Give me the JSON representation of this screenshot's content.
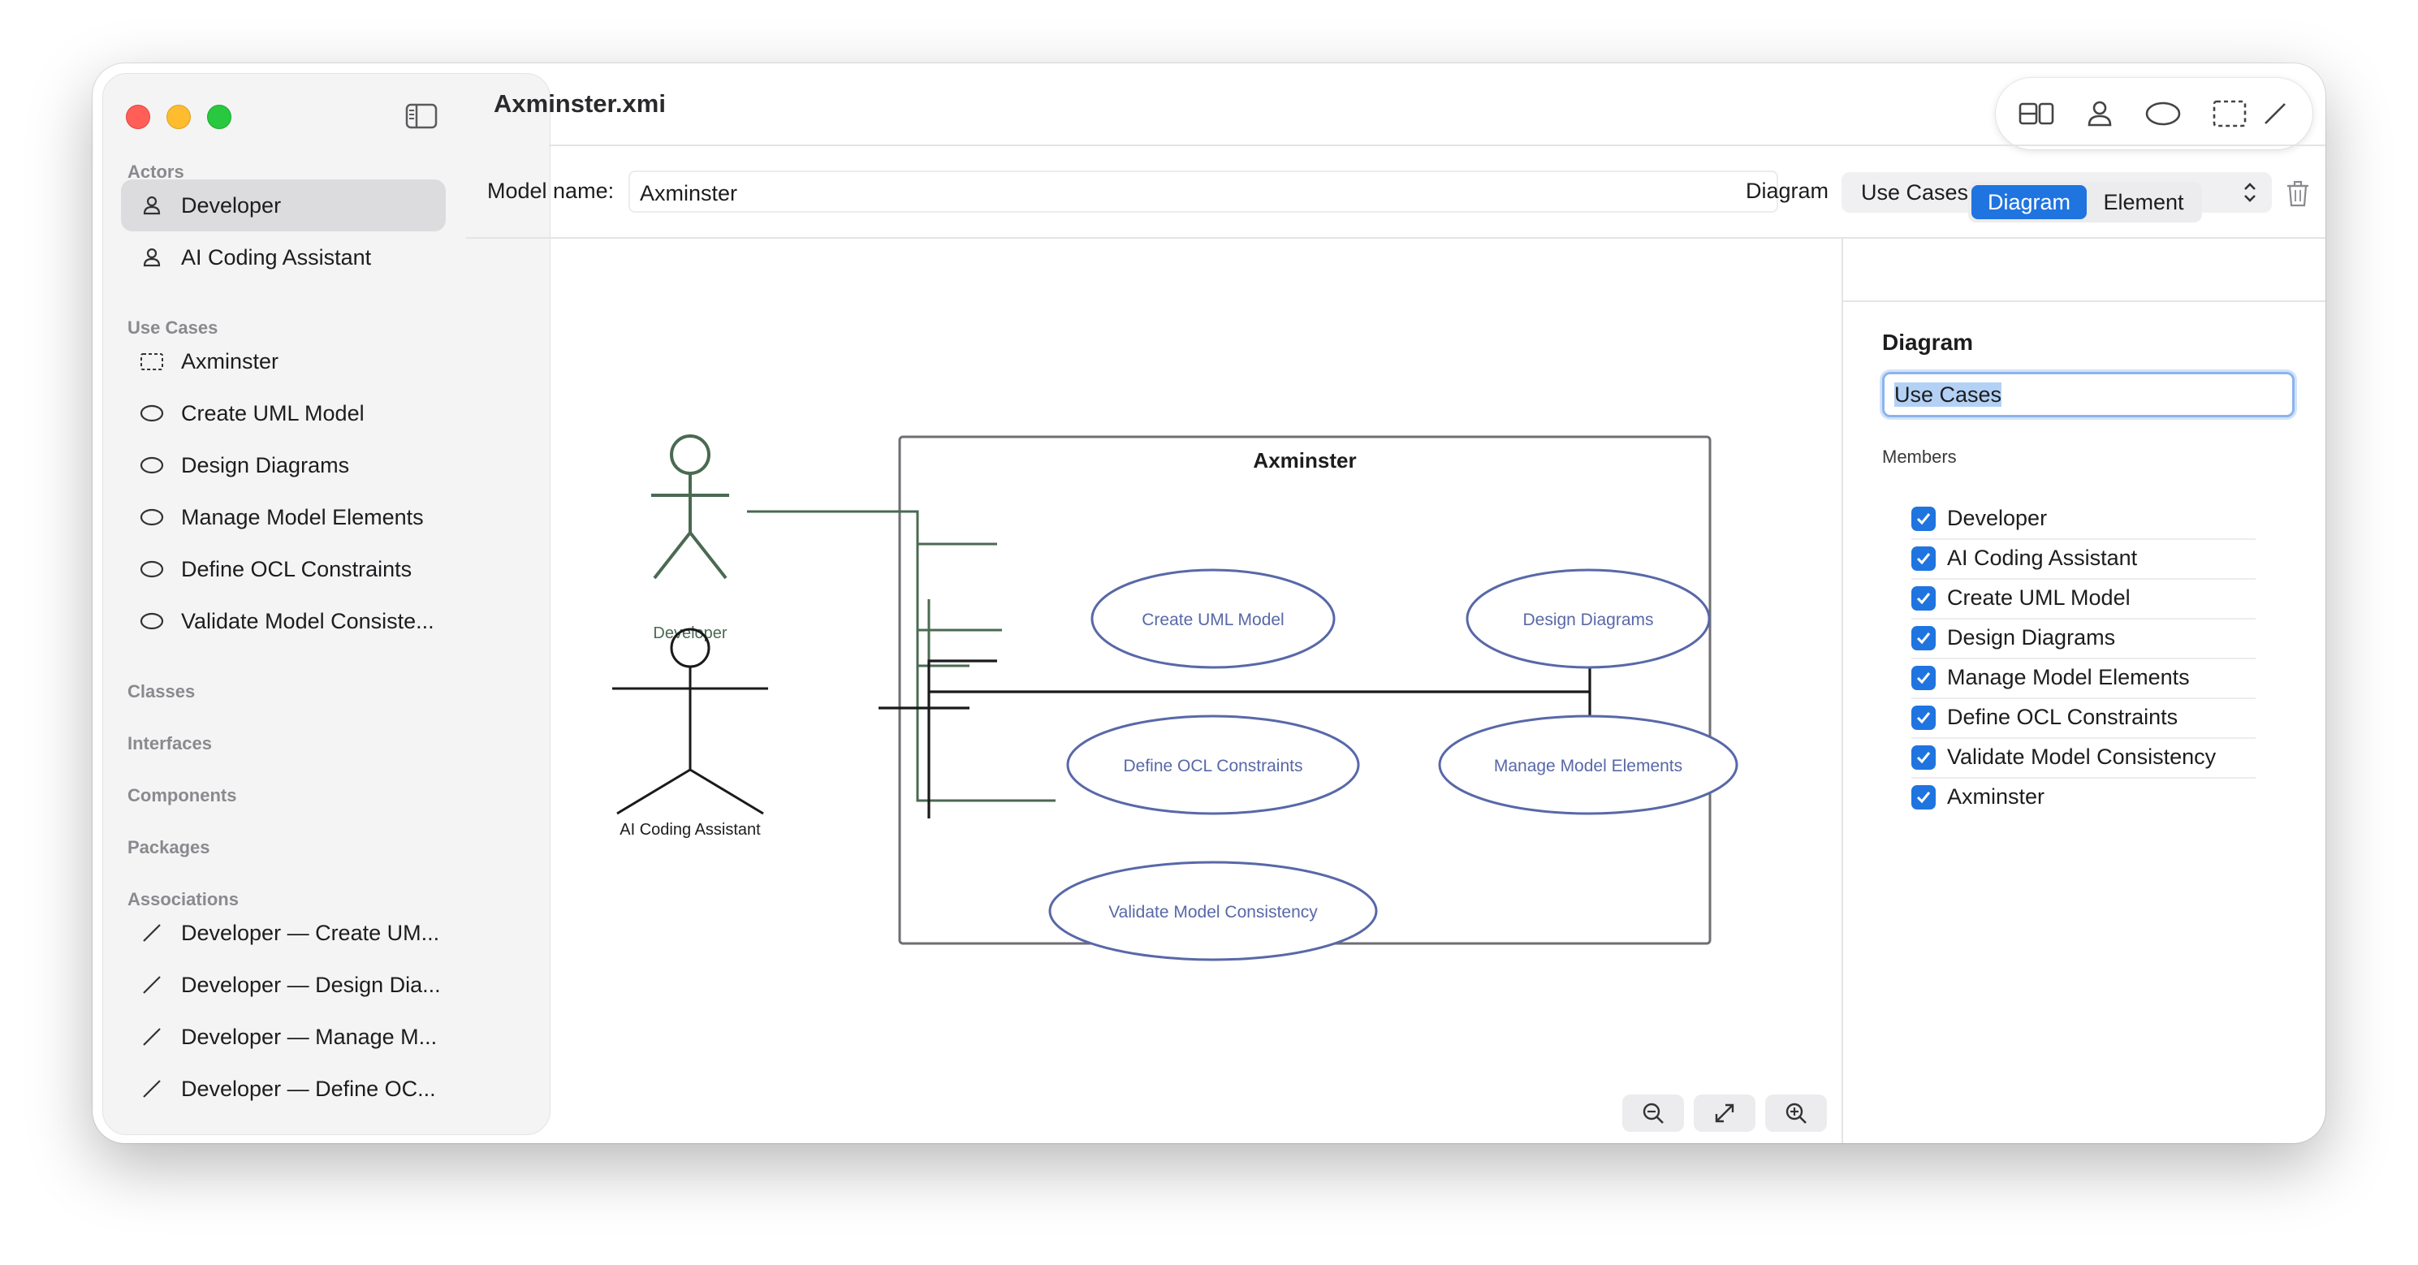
{
  "window": {
    "title": "Axminster.xmi"
  },
  "sidebar": {
    "sections": [
      {
        "title": "Actors",
        "items": [
          {
            "label": "Developer",
            "icon": "person-icon",
            "selected": true
          },
          {
            "label": "AI Coding Assistant",
            "icon": "person-icon"
          }
        ]
      },
      {
        "title": "Use Cases",
        "items": [
          {
            "label": "Axminster",
            "icon": "boundary-icon"
          },
          {
            "label": "Create UML Model",
            "icon": "ellipse-icon"
          },
          {
            "label": "Design Diagrams",
            "icon": "ellipse-icon"
          },
          {
            "label": "Manage Model Elements",
            "icon": "ellipse-icon"
          },
          {
            "label": "Define OCL Constraints",
            "icon": "ellipse-icon"
          },
          {
            "label": "Validate Model Consiste...",
            "icon": "ellipse-icon"
          }
        ]
      },
      {
        "title": "Classes",
        "items": []
      },
      {
        "title": "Interfaces",
        "items": []
      },
      {
        "title": "Components",
        "items": []
      },
      {
        "title": "Packages",
        "items": []
      },
      {
        "title": "Associations",
        "items": [
          {
            "label": "Developer — Create UM...",
            "icon": "line-icon"
          },
          {
            "label": "Developer — Design Dia...",
            "icon": "line-icon"
          },
          {
            "label": "Developer — Manage M...",
            "icon": "line-icon"
          },
          {
            "label": "Developer — Define OC...",
            "icon": "line-icon"
          }
        ]
      }
    ]
  },
  "toolbar": {
    "buttons": [
      "layout-icon",
      "actor-tool-icon",
      "use-case-tool-icon",
      "boundary-tool-icon",
      "association-tool-icon"
    ]
  },
  "model": {
    "name_label": "Model name:",
    "name_value": "Axminster",
    "diagram_label": "Diagram",
    "diagram_value": "Use Cases"
  },
  "diagram": {
    "system_name": "Axminster",
    "actors": [
      "Developer",
      "AI Coding Assistant"
    ],
    "use_cases": [
      "Create UML Model",
      "Design Diagrams",
      "Define OCL Constraints",
      "Manage Model Elements",
      "Validate Model Consistency"
    ],
    "colors": {
      "actor": "#4a6a52",
      "use_case": "#5868a8",
      "line_dark": "#1a1a1a"
    }
  },
  "zoom": {
    "buttons": [
      "zoom-out-icon",
      "fit-icon",
      "zoom-in-icon"
    ]
  },
  "inspector": {
    "tabs": [
      "Diagram",
      "Element"
    ],
    "active_tab": "Diagram",
    "heading": "Diagram",
    "name_value": "Use Cases",
    "members_label": "Members",
    "members": [
      "Developer",
      "AI Coding Assistant",
      "Create UML Model",
      "Design Diagrams",
      "Manage Model Elements",
      "Define OCL Constraints",
      "Validate Model Consistency",
      "Axminster"
    ]
  }
}
